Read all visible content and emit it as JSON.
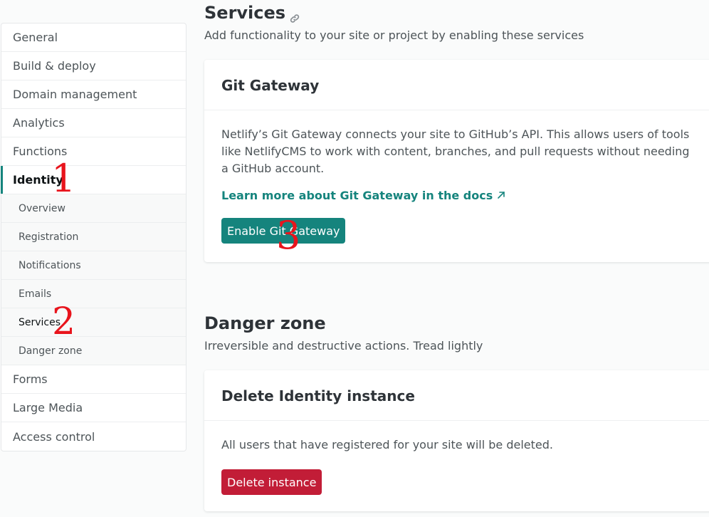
{
  "sidebar": {
    "items": [
      {
        "label": "General"
      },
      {
        "label": "Build & deploy"
      },
      {
        "label": "Domain management"
      },
      {
        "label": "Analytics"
      },
      {
        "label": "Functions"
      },
      {
        "label": "Identity"
      },
      {
        "label": "Forms"
      },
      {
        "label": "Large Media"
      },
      {
        "label": "Access control"
      }
    ],
    "identity_sub": [
      {
        "label": "Overview"
      },
      {
        "label": "Registration"
      },
      {
        "label": "Notifications"
      },
      {
        "label": "Emails"
      },
      {
        "label": "Services"
      },
      {
        "label": "Danger zone"
      }
    ]
  },
  "services": {
    "title": "Services",
    "description": "Add functionality to your site or project by enabling these services",
    "card": {
      "title": "Git Gateway",
      "text": "Netlify’s Git Gateway connects your site to GitHub’s API. This allows users of tools like NetlifyCMS to work with content, branches, and pull requests without needing a GitHub account.",
      "link_label": "Learn more about Git Gateway in the docs",
      "button_label": "Enable Git Gateway"
    }
  },
  "danger": {
    "title": "Danger zone",
    "description": "Irreversible and destructive actions. Tread lightly",
    "card": {
      "title": "Delete Identity instance",
      "text": "All users that have registered for your site will be deleted.",
      "button_label": "Delete instance"
    }
  },
  "annotations": {
    "one": "1",
    "two": "2",
    "three": "3"
  },
  "colors": {
    "accent": "#15847d",
    "danger": "#c21d37",
    "annotation": "#e8141c"
  }
}
